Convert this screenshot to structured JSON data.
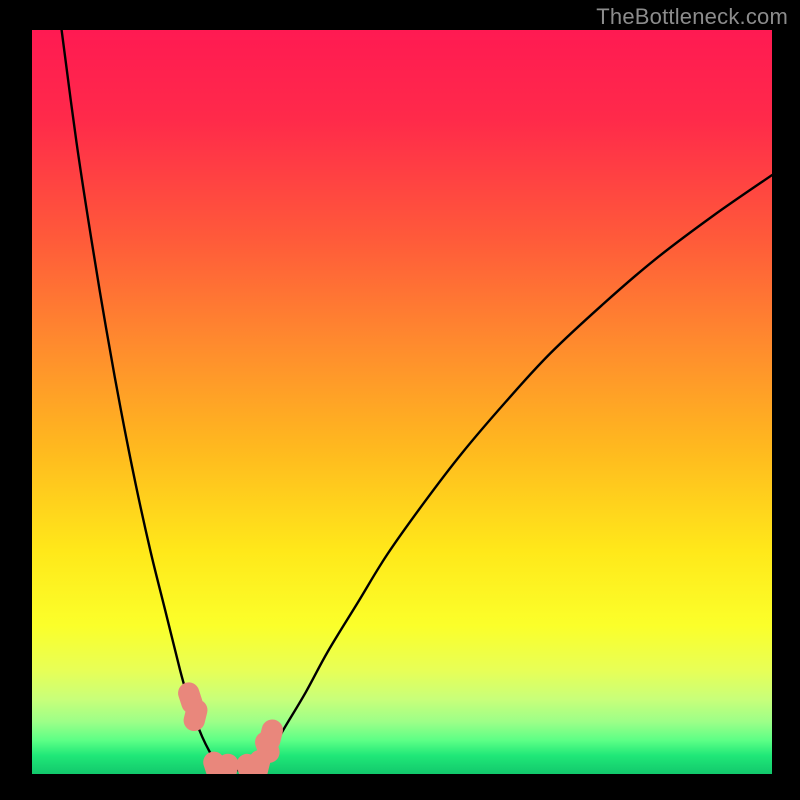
{
  "watermark": "TheBottleneck.com",
  "colors": {
    "frame": "#000000",
    "gradient_stops": [
      {
        "offset": 0.0,
        "color": "#ff1a52"
      },
      {
        "offset": 0.12,
        "color": "#ff2a4a"
      },
      {
        "offset": 0.28,
        "color": "#ff5a3a"
      },
      {
        "offset": 0.42,
        "color": "#ff8a2e"
      },
      {
        "offset": 0.56,
        "color": "#ffb81f"
      },
      {
        "offset": 0.7,
        "color": "#ffe81a"
      },
      {
        "offset": 0.8,
        "color": "#fbff2a"
      },
      {
        "offset": 0.86,
        "color": "#e8ff56"
      },
      {
        "offset": 0.9,
        "color": "#c8ff7a"
      },
      {
        "offset": 0.93,
        "color": "#9cff88"
      },
      {
        "offset": 0.955,
        "color": "#5cff86"
      },
      {
        "offset": 0.975,
        "color": "#20e878"
      },
      {
        "offset": 1.0,
        "color": "#12c86c"
      }
    ],
    "curve": "#000000",
    "marker_fill": "#e9877c",
    "marker_stroke": "#e9877c"
  },
  "layout": {
    "outer_w": 800,
    "outer_h": 800,
    "inner_x": 32,
    "inner_y": 30,
    "inner_w": 740,
    "inner_h": 744
  },
  "chart_data": {
    "type": "line",
    "title": "",
    "xlabel": "",
    "ylabel": "",
    "xlim": [
      0,
      100
    ],
    "ylim": [
      0,
      100
    ],
    "series": [
      {
        "name": "left-branch",
        "x": [
          4,
          6,
          8,
          10,
          12,
          14,
          16,
          18,
          20,
          21,
          22,
          23,
          24,
          25,
          26
        ],
        "y": [
          100,
          85,
          72,
          60,
          49,
          39,
          30,
          22,
          14,
          10.5,
          7.5,
          5,
          3,
          1.4,
          0.6
        ]
      },
      {
        "name": "right-branch",
        "x": [
          30,
          32,
          34,
          37,
          40,
          44,
          48,
          53,
          58,
          64,
          70,
          77,
          84,
          92,
          100
        ],
        "y": [
          0.6,
          2.5,
          6,
          11,
          16.5,
          23,
          29.5,
          36.5,
          43,
          50,
          56.5,
          63,
          69,
          75,
          80.5
        ]
      }
    ],
    "floor_band": {
      "y": 0.5,
      "x_start": 24.5,
      "x_end": 31
    },
    "markers": [
      {
        "x": 21.4,
        "y": 10.2,
        "r": 1.6
      },
      {
        "x": 22.1,
        "y": 7.9,
        "r": 1.6
      },
      {
        "x": 24.8,
        "y": 0.9,
        "r": 1.6
      },
      {
        "x": 26.3,
        "y": 0.6,
        "r": 1.6
      },
      {
        "x": 29.3,
        "y": 0.6,
        "r": 1.6
      },
      {
        "x": 30.6,
        "y": 1.1,
        "r": 1.6
      },
      {
        "x": 31.8,
        "y": 3.6,
        "r": 1.6
      },
      {
        "x": 32.3,
        "y": 5.2,
        "r": 1.6
      }
    ]
  }
}
